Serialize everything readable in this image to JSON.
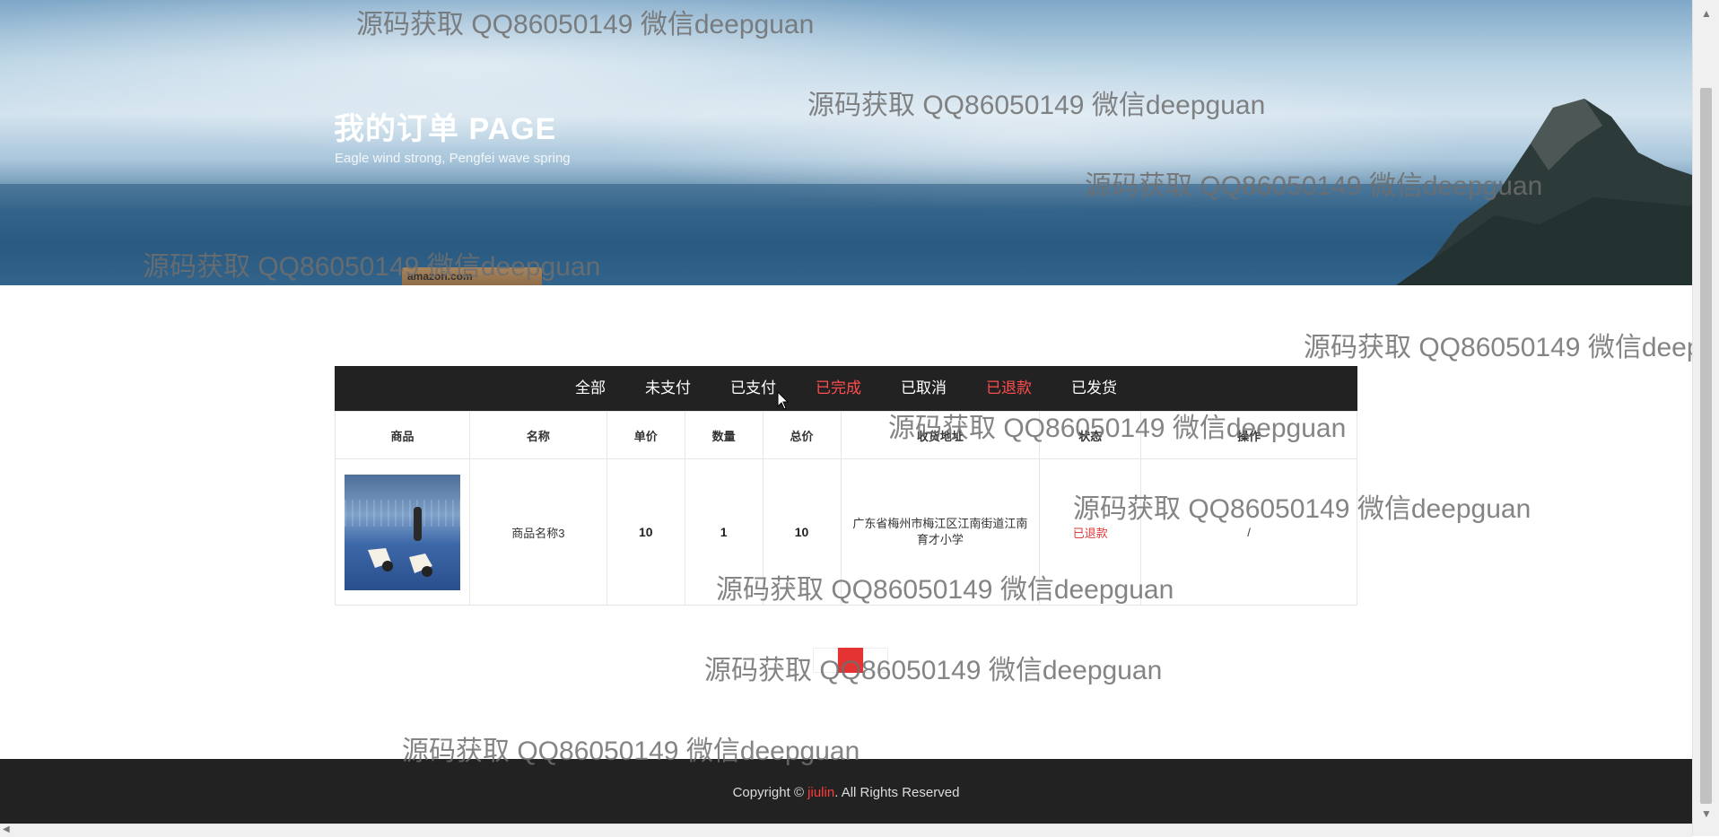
{
  "banner": {
    "title": "我的订单 PAGE",
    "subtitle": "Eagle wind strong, Pengfei wave spring",
    "box_text": "amazon.com"
  },
  "tabs": [
    {
      "label": "全部",
      "highlight": false
    },
    {
      "label": "未支付",
      "highlight": false
    },
    {
      "label": "已支付",
      "highlight": false
    },
    {
      "label": "已完成",
      "highlight": true
    },
    {
      "label": "已取消",
      "highlight": false
    },
    {
      "label": "已退款",
      "highlight": true
    },
    {
      "label": "已发货",
      "highlight": false
    }
  ],
  "table": {
    "headers": [
      "商品",
      "名称",
      "单价",
      "数量",
      "总价",
      "收货地址",
      "状态",
      "操作"
    ],
    "rows": [
      {
        "image_icon": "badminton-shuttlecock-image",
        "name": "商品名称3",
        "price": "10",
        "quantity": "1",
        "total": "10",
        "address": "广东省梅州市梅江区江南街道江南育才小学",
        "status": "已退款",
        "action": "/"
      }
    ]
  },
  "pagination": {
    "current_page": 1,
    "pages": [
      ""
    ]
  },
  "footer": {
    "prefix": "Copyright © ",
    "brand": "jiulin",
    "suffix": ". All Rights Reserved"
  },
  "watermark": "源码获取 QQ86050149 微信deepguan",
  "watermark_partial": "源码获取 QQ86050149 微信deep",
  "colors": {
    "accent_red": "#e53333",
    "dark_bar": "#222222"
  }
}
